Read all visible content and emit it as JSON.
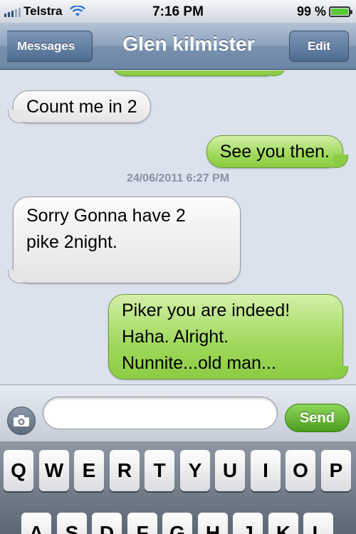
{
  "status_bar": {
    "carrier": "Telstra",
    "time": "7:16 PM",
    "battery_text": "99 %",
    "battery_level": 0.99,
    "signal_icon": "signal-bars-icon",
    "wifi_icon": "wifi-icon"
  },
  "nav": {
    "back_label": "Messages",
    "title": "Glen kilmister",
    "edit_label": "Edit"
  },
  "messages": [
    {
      "direction": "in",
      "text": "Count me in 2"
    },
    {
      "direction": "out",
      "text": "See you then."
    },
    {
      "direction": "in",
      "text": "Sorry Gonna have 2\npike 2night."
    },
    {
      "direction": "out",
      "text": "Piker you are indeed!\nHaha. Alright.\nNunnite...old man..."
    }
  ],
  "timestamp": "24/06/2011 6:27 PM",
  "compose": {
    "camera_icon": "camera-icon",
    "input_value": "",
    "send_label": "Send"
  },
  "keyboard": {
    "row1": [
      "Q",
      "W",
      "E",
      "R",
      "T",
      "Y",
      "U",
      "I",
      "O",
      "P"
    ],
    "row2": [
      "A",
      "S",
      "D",
      "F",
      "G",
      "H",
      "J",
      "K",
      "L"
    ]
  },
  "colors": {
    "incoming_bubble": "#e6e6e6",
    "outgoing_bubble": "#9fd85a",
    "nav_bar": "#7890ae",
    "send_button": "#4c9b1f"
  }
}
